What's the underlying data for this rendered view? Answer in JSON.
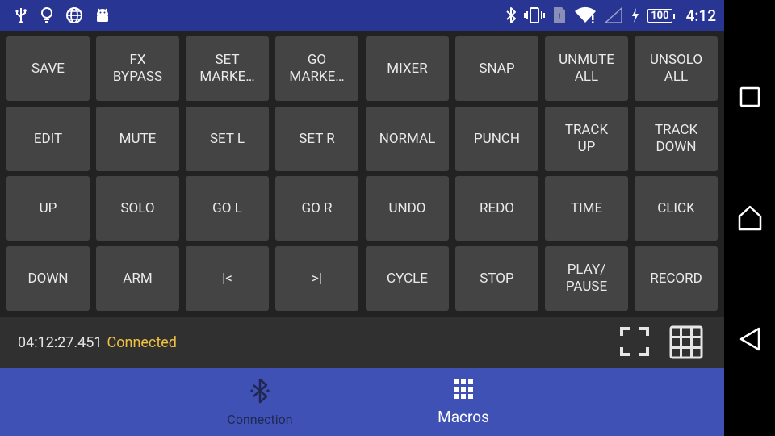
{
  "status_bar": {
    "left_icons": [
      "usb-icon",
      "lightbulb-icon",
      "globe-icon",
      "android-icon"
    ],
    "right_icons": [
      "bluetooth-icon",
      "vibrate-icon",
      "sim-card-icon",
      "wifi-icon",
      "cell-signal-icon",
      "charging-icon"
    ],
    "battery": "100",
    "clock": "4:12"
  },
  "buttons": [
    [
      "SAVE",
      "FX\nBYPASS",
      "SET\nMARKE…",
      "GO\nMARKE…",
      "MIXER",
      "SNAP",
      "UNMUTE\nALL",
      "UNSOLO\nALL"
    ],
    [
      "EDIT",
      "MUTE",
      "SET L",
      "SET R",
      "NORMAL",
      "PUNCH",
      "TRACK\nUP",
      "TRACK\nDOWN"
    ],
    [
      "UP",
      "SOLO",
      "GO L",
      "GO R",
      "UNDO",
      "REDO",
      "TIME",
      "CLICK"
    ],
    [
      "DOWN",
      "ARM",
      "|<",
      ">|",
      "CYCLE",
      "STOP",
      "PLAY/\nPAUSE",
      "RECORD"
    ]
  ],
  "info_bar": {
    "time": "04:12:27.451",
    "status": "Connected",
    "icons": [
      "fullscreen-icon",
      "grid-icon"
    ]
  },
  "bottom_nav": {
    "tabs": [
      {
        "label": "Connection",
        "icon": "bluetooth-icon",
        "active": false
      },
      {
        "label": "Macros",
        "icon": "grid-dots-icon",
        "active": true
      }
    ]
  },
  "system_nav": [
    "recents-icon",
    "home-icon",
    "back-icon"
  ],
  "colors": {
    "status_bar": "#283593",
    "bottom_nav": "#3f51b5",
    "button": "#444444",
    "connected": "#f0c040"
  }
}
